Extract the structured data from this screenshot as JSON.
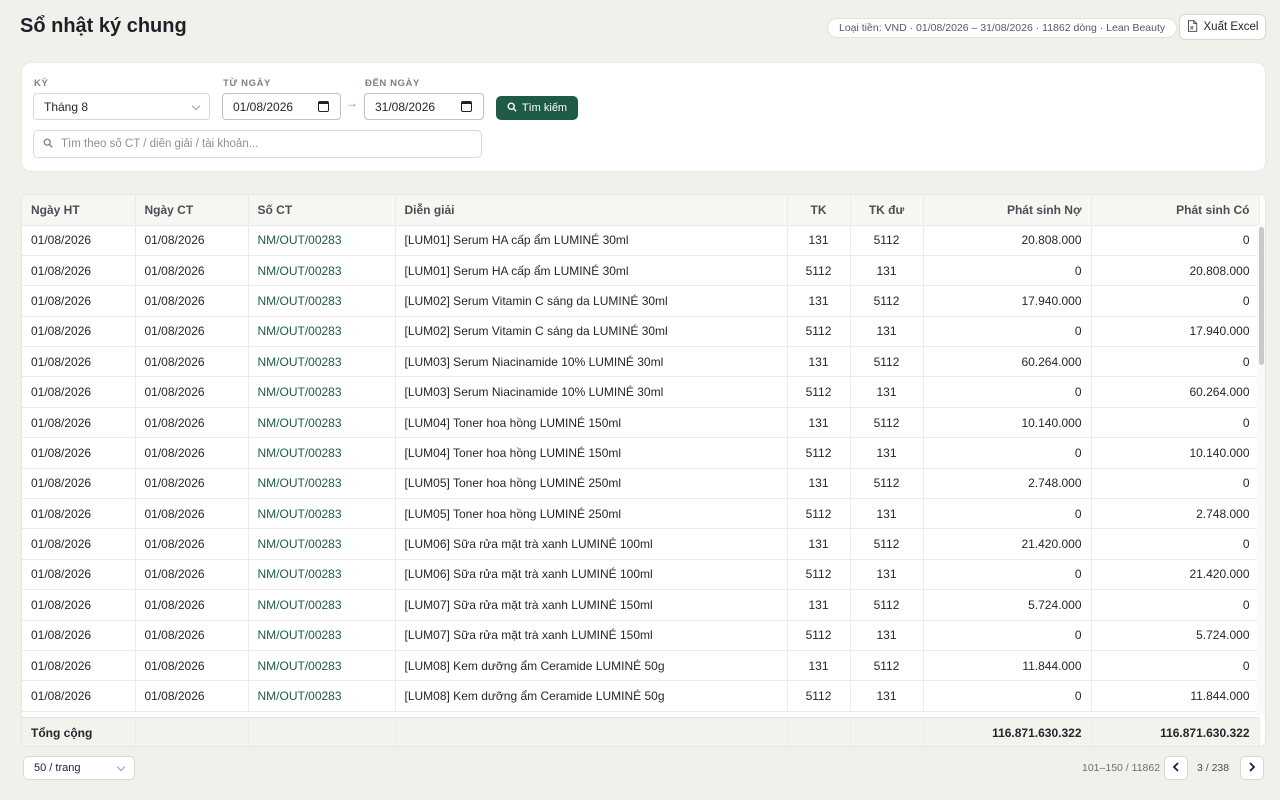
{
  "header": {
    "title": "Sổ nhật ký chung",
    "meta": "Loại tiền: VND · 01/08/2026 – 31/08/2026 · 11862 dòng · Lean Beauty",
    "export_label": "Xuất Excel"
  },
  "filters": {
    "period_label": "KỲ",
    "period_value": "Tháng 8",
    "from_label": "TỪ NGÀY",
    "from_value": "01/08/2026",
    "to_label": "ĐẾN NGÀY",
    "to_value": "31/08/2026",
    "search_button": "Tìm kiếm",
    "search_placeholder": "Tìm theo số CT / diễn giải / tài khoản..."
  },
  "table": {
    "columns": [
      "Ngày HT",
      "Ngày CT",
      "Số CT",
      "Diễn giải",
      "TK",
      "TK đư",
      "Phát sinh Nợ",
      "Phát sinh Có"
    ],
    "rows": [
      [
        "01/08/2026",
        "01/08/2026",
        "NM/OUT/00283",
        "[LUM01] Serum HA cấp ẩm LUMINÉ 30ml",
        "131",
        "5112",
        "20.808.000",
        "0"
      ],
      [
        "01/08/2026",
        "01/08/2026",
        "NM/OUT/00283",
        "[LUM01] Serum HA cấp ẩm LUMINÉ 30ml",
        "5112",
        "131",
        "0",
        "20.808.000"
      ],
      [
        "01/08/2026",
        "01/08/2026",
        "NM/OUT/00283",
        "[LUM02] Serum Vitamin C sáng da LUMINÉ 30ml",
        "131",
        "5112",
        "17.940.000",
        "0"
      ],
      [
        "01/08/2026",
        "01/08/2026",
        "NM/OUT/00283",
        "[LUM02] Serum Vitamin C sáng da LUMINÉ 30ml",
        "5112",
        "131",
        "0",
        "17.940.000"
      ],
      [
        "01/08/2026",
        "01/08/2026",
        "NM/OUT/00283",
        "[LUM03] Serum Niacinamide 10% LUMINÉ 30ml",
        "131",
        "5112",
        "60.264.000",
        "0"
      ],
      [
        "01/08/2026",
        "01/08/2026",
        "NM/OUT/00283",
        "[LUM03] Serum Niacinamide 10% LUMINÉ 30ml",
        "5112",
        "131",
        "0",
        "60.264.000"
      ],
      [
        "01/08/2026",
        "01/08/2026",
        "NM/OUT/00283",
        "[LUM04] Toner hoa hồng LUMINÉ 150ml",
        "131",
        "5112",
        "10.140.000",
        "0"
      ],
      [
        "01/08/2026",
        "01/08/2026",
        "NM/OUT/00283",
        "[LUM04] Toner hoa hồng LUMINÉ 150ml",
        "5112",
        "131",
        "0",
        "10.140.000"
      ],
      [
        "01/08/2026",
        "01/08/2026",
        "NM/OUT/00283",
        "[LUM05] Toner hoa hồng LUMINÉ 250ml",
        "131",
        "5112",
        "2.748.000",
        "0"
      ],
      [
        "01/08/2026",
        "01/08/2026",
        "NM/OUT/00283",
        "[LUM05] Toner hoa hồng LUMINÉ 250ml",
        "5112",
        "131",
        "0",
        "2.748.000"
      ],
      [
        "01/08/2026",
        "01/08/2026",
        "NM/OUT/00283",
        "[LUM06] Sữa rửa mặt trà xanh LUMINÉ 100ml",
        "131",
        "5112",
        "21.420.000",
        "0"
      ],
      [
        "01/08/2026",
        "01/08/2026",
        "NM/OUT/00283",
        "[LUM06] Sữa rửa mặt trà xanh LUMINÉ 100ml",
        "5112",
        "131",
        "0",
        "21.420.000"
      ],
      [
        "01/08/2026",
        "01/08/2026",
        "NM/OUT/00283",
        "[LUM07] Sữa rửa mặt trà xanh LUMINÉ 150ml",
        "131",
        "5112",
        "5.724.000",
        "0"
      ],
      [
        "01/08/2026",
        "01/08/2026",
        "NM/OUT/00283",
        "[LUM07] Sữa rửa mặt trà xanh LUMINÉ 150ml",
        "5112",
        "131",
        "0",
        "5.724.000"
      ],
      [
        "01/08/2026",
        "01/08/2026",
        "NM/OUT/00283",
        "[LUM08] Kem dưỡng ẩm Ceramide LUMINÉ 50g",
        "131",
        "5112",
        "11.844.000",
        "0"
      ],
      [
        "01/08/2026",
        "01/08/2026",
        "NM/OUT/00283",
        "[LUM08] Kem dưỡng ẩm Ceramide LUMINÉ 50g",
        "5112",
        "131",
        "0",
        "11.844.000"
      ]
    ],
    "total_label": "Tổng cộng",
    "total_debit": "116.871.630.322",
    "total_credit": "116.871.630.322"
  },
  "pagination": {
    "per_page": "50 / trang",
    "range": "101–150 / 11862",
    "page": "3 / 238"
  },
  "icons": {
    "export": "file-excel-icon",
    "search": "search-icon",
    "calendar": "calendar-icon",
    "prev": "chevron-left-icon",
    "next": "chevron-right-icon"
  },
  "colors": {
    "accent": "#1f5a46",
    "background": "#f1f1ec"
  }
}
